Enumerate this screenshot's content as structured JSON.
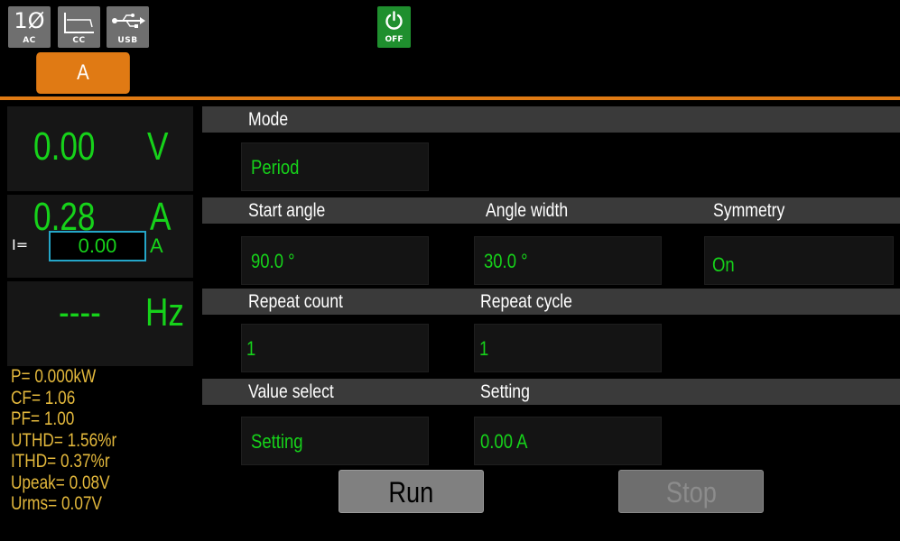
{
  "status_bar": {
    "phase_symbol": "1Ø",
    "phase_caption": "AC",
    "mode_caption": "CC",
    "interface_caption": "USB",
    "output_state": "OFF",
    "channel_tab": "A"
  },
  "measurements": {
    "voltage": {
      "value": "0.00",
      "unit": "V"
    },
    "current": {
      "value": "0.28",
      "unit": "A",
      "set_label": "I=",
      "set_value": "0.00",
      "set_unit": "A"
    },
    "frequency": {
      "value": "----",
      "unit": "Hz"
    },
    "stats": [
      "P=  0.000kW",
      "CF= 1.06",
      "PF= 1.00",
      "UTHD=  1.56%r",
      "ITHD=  0.37%r",
      "Upeak=  0.08V",
      "Urms=  0.07V"
    ]
  },
  "settings": {
    "mode": {
      "label": "Mode",
      "value": "Period"
    },
    "start_angle": {
      "label": "Start angle",
      "value": "90.0 °"
    },
    "angle_width": {
      "label": "Angle width",
      "value": "30.0 °"
    },
    "symmetry": {
      "label": "Symmetry",
      "value": "On"
    },
    "repeat_count": {
      "label": "Repeat count",
      "value": "1"
    },
    "repeat_cycle": {
      "label": "Repeat cycle",
      "value": "1"
    },
    "value_select": {
      "label": "Value select",
      "value": "Setting"
    },
    "setting": {
      "label": "Setting",
      "value": "0.00 A"
    }
  },
  "actions": {
    "run_label": "Run",
    "stop_label": "Stop"
  },
  "colors": {
    "accent": "#e07a14",
    "reading": "#16d21a",
    "stats": "#e3b83c",
    "power_off": "#1f8f2e",
    "focus": "#24a6c8"
  }
}
